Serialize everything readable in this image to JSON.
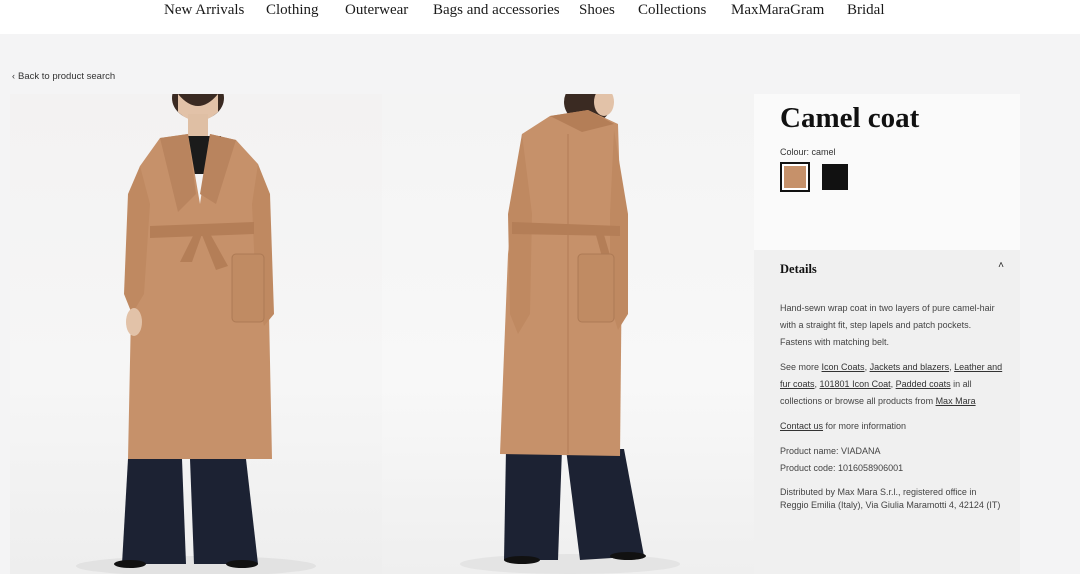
{
  "nav": {
    "items": [
      "New Arrivals",
      "Clothing",
      "Outerwear",
      "Bags and accessories",
      "Shoes",
      "Collections",
      "MaxMaraGram",
      "Bridal"
    ]
  },
  "back_link": {
    "chevron": "‹",
    "label": "Back to product search"
  },
  "product": {
    "title": "Camel coat",
    "colour_label": "Colour:",
    "colour_value": "camel",
    "swatches": [
      {
        "name": "camel",
        "hex": "#c6916a"
      },
      {
        "name": "black",
        "hex": "#111111"
      }
    ]
  },
  "details": {
    "heading": "Details",
    "caret": "˄",
    "description": "Hand-sewn wrap coat in two layers of pure camel-hair with a straight fit, step lapels and patch pockets. Fastens with matching belt.",
    "see_more_prefix": "See more ",
    "links": [
      "Icon Coats",
      "Jackets and blazers",
      "Leather and fur coats",
      "101801 Icon Coat",
      "Padded coats"
    ],
    "see_more_middle": " in all collections or browse all products from ",
    "brand_link": "Max Mara",
    "contact_link": "Contact us",
    "contact_suffix": " for more information",
    "product_name": "Product name: VIADANA",
    "product_code": "Product code: 1016058906001",
    "distributor": "Distributed by Max Mara S.r.l., registered office in Reggio Emilia (Italy), Via Giulia Maramotti 4, 42124 (IT)"
  },
  "colors": {
    "camel": "#c6916a",
    "trousers": "#1c2233",
    "background": "#f4f4f5"
  }
}
